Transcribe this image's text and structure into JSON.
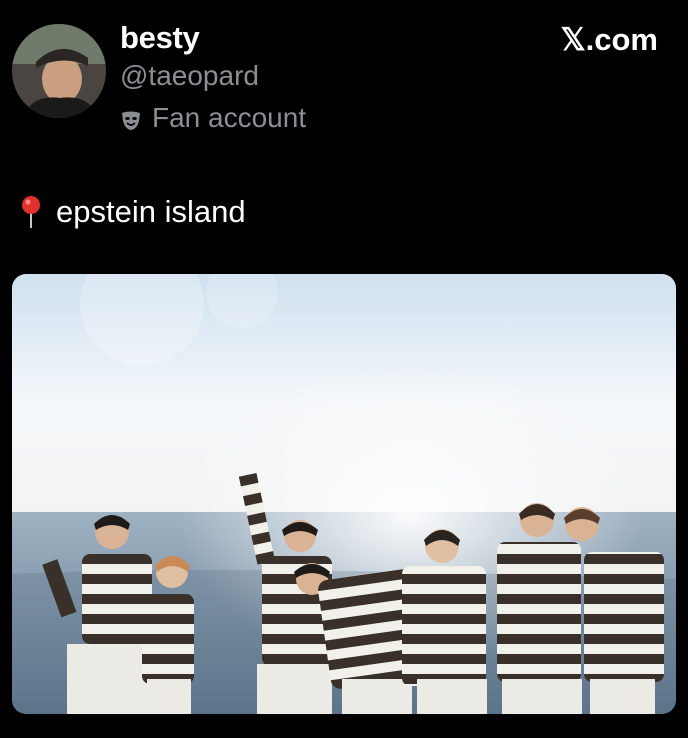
{
  "header": {
    "display_name": "besty",
    "handle": "@taeopard",
    "badge_label": "Fan account",
    "badge_icon": "theater-mask-icon",
    "source": "𝕏.com"
  },
  "post": {
    "pin_icon": "round-pushpin-icon",
    "text": "epstein island"
  },
  "media": {
    "type": "photo",
    "colors": {
      "sky": "#eef3f7",
      "sea": "#7e97ab",
      "stripe_dark": "#3a302a",
      "stripe_light": "#f2f0ea"
    }
  }
}
